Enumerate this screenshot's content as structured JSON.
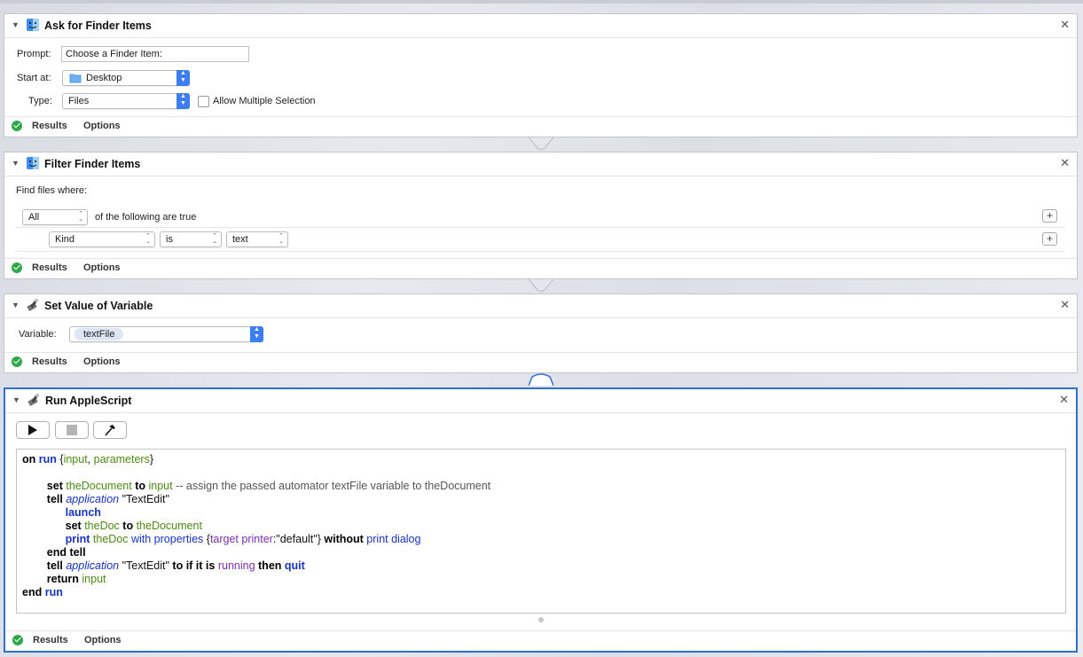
{
  "actions": [
    {
      "title": "Ask for Finder Items",
      "prompt_label": "Prompt:",
      "prompt_value": "Choose a Finder Item:",
      "start_label": "Start at:",
      "start_value": "Desktop",
      "type_label": "Type:",
      "type_value": "Files",
      "allow_multiple_label": "Allow Multiple Selection",
      "results": "Results",
      "options": "Options"
    },
    {
      "title": "Filter Finder Items",
      "find_label": "Find files where:",
      "match_value": "All",
      "match_suffix": "of the following are true",
      "criteria_field": "Kind",
      "criteria_op": "is",
      "criteria_value": "text",
      "results": "Results",
      "options": "Options"
    },
    {
      "title": "Set Value of Variable",
      "variable_label": "Variable:",
      "variable_value": "textFile",
      "results": "Results",
      "options": "Options"
    },
    {
      "title": "Run AppleScript",
      "results": "Results",
      "options": "Options",
      "code": {
        "l1_on": "on",
        "l1_run": "run",
        "l1_open": " {",
        "l1_input": "input",
        "l1_comma": ", ",
        "l1_params": "parameters",
        "l1_close": "}",
        "l3_set": "set",
        "l3_thedocument": "theDocument",
        "l3_to": "to",
        "l3_input": "input",
        "l3_comment": "-- assign the passed automator textFile variable to theDocument",
        "l4_tell": "tell",
        "l4_application": "application",
        "l4_str": "\"TextEdit\"",
        "l5_launch": "launch",
        "l6_set": "set",
        "l6_thedoc": "theDoc",
        "l6_to": "to",
        "l6_thedocument": "theDocument",
        "l7_print": "print",
        "l7_thedoc": "theDoc",
        "l7_with_properties": "with properties",
        "l7_open": " {",
        "l7_target_printer": "target printer",
        "l7_colon": ":",
        "l7_default": "\"default\"",
        "l7_close": "}",
        "l7_without": "without",
        "l7_print_dialog": "print dialog",
        "l8_end_tell": "end tell",
        "l9_tell": "tell",
        "l9_application": "application",
        "l9_str": "\"TextEdit\"",
        "l9_to_if_it_is": "to if it is",
        "l9_running": "running",
        "l9_then": "then",
        "l9_quit": "quit",
        "l10_return": "return",
        "l10_input": "input",
        "l11_end": "end",
        "l11_run": "run"
      }
    }
  ],
  "icons": {
    "finder": "finder-icon",
    "variable": "variable-icon",
    "applescript": "applescript-icon",
    "close": "close-icon",
    "disclosure": "disclosure-triangle-icon",
    "folder": "folder-icon",
    "check": "checkmark-icon"
  },
  "colors": {
    "accent": "#2d6fd2",
    "stepper": "#3c7ef0",
    "success": "#2fa84a",
    "keyword_blue": "#1532c9",
    "variable_green": "#4c8b12",
    "property_purple": "#7a2fa8"
  }
}
